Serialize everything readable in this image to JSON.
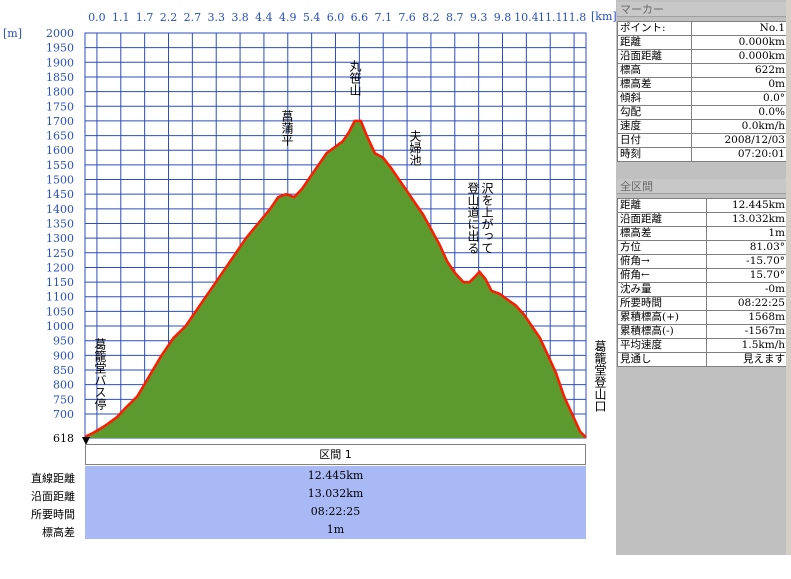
{
  "units": {
    "x": "[km]",
    "y": "[m]"
  },
  "chart_data": {
    "type": "area",
    "xlabel": "[km]",
    "ylabel": "[m]",
    "x_ticks": [
      "0.0",
      "1.1",
      "1.7",
      "2.2",
      "2.7",
      "3.3",
      "3.8",
      "4.4",
      "4.9",
      "5.4",
      "6.0",
      "6.6",
      "7.1",
      "7.6",
      "8.2",
      "8.7",
      "9.3",
      "9.8",
      "10.4",
      "11.1",
      "11.8"
    ],
    "y_ticks": [
      2000,
      1950,
      1900,
      1850,
      1800,
      1750,
      1700,
      1650,
      1600,
      1550,
      1500,
      1450,
      1400,
      1350,
      1300,
      1250,
      1200,
      1150,
      1100,
      1050,
      1000,
      950,
      900,
      850,
      800,
      750,
      700
    ],
    "y_min_label": "618",
    "ylim": [
      618,
      2000
    ],
    "xlim": [
      0,
      12.445
    ],
    "grid": true,
    "series": [
      {
        "x": [
          0,
          0.2,
          0.5,
          0.8,
          1.0,
          1.3,
          1.6,
          1.9,
          2.2,
          2.5,
          2.8,
          3.1,
          3.4,
          3.7,
          4.0,
          4.3,
          4.6,
          4.8,
          5.0,
          5.2,
          5.4,
          5.6,
          5.8,
          6.0,
          6.2,
          6.4,
          6.55,
          6.7,
          6.85,
          7.0,
          7.2,
          7.4,
          7.6,
          7.8,
          8.0,
          8.2,
          8.4,
          8.6,
          8.8,
          9.0,
          9.2,
          9.4,
          9.55,
          9.7,
          9.8,
          9.95,
          10.1,
          10.3,
          10.5,
          10.7,
          10.9,
          11.1,
          11.3,
          11.5,
          11.7,
          11.9,
          12.1,
          12.3,
          12.445
        ],
        "values": [
          622,
          635,
          660,
          690,
          720,
          760,
          830,
          900,
          960,
          1000,
          1060,
          1120,
          1180,
          1240,
          1300,
          1350,
          1400,
          1440,
          1450,
          1440,
          1470,
          1510,
          1550,
          1590,
          1610,
          1630,
          1660,
          1700,
          1700,
          1650,
          1590,
          1575,
          1540,
          1500,
          1460,
          1420,
          1380,
          1330,
          1280,
          1220,
          1180,
          1150,
          1150,
          1170,
          1185,
          1160,
          1120,
          1110,
          1090,
          1070,
          1040,
          1000,
          960,
          900,
          840,
          760,
          700,
          640,
          620
        ]
      }
    ],
    "annotations": [
      "菖蒲平",
      "丸笹山",
      "夫婦池",
      "沢を上がって",
      "登山道に出る",
      "葛籠堂バス停",
      "葛籠堂登山口"
    ]
  },
  "segment": {
    "header": "区間 1",
    "rows": [
      {
        "label": "直線距離",
        "value": "12.445km"
      },
      {
        "label": "沿面距離",
        "value": "13.032km"
      },
      {
        "label": "所要時間",
        "value": "08:22:25"
      },
      {
        "label": "標高差",
        "value": "1m"
      }
    ]
  },
  "marker_panel": {
    "title": "マーカー",
    "rows": [
      {
        "label": "ポイント:",
        "value": "No.1"
      },
      {
        "label": "距離",
        "value": "0.000km"
      },
      {
        "label": "沿面距離",
        "value": "0.000km"
      },
      {
        "label": "標高",
        "value": "622m"
      },
      {
        "label": "標高差",
        "value": "0m"
      },
      {
        "label": "傾斜",
        "value": "0.0°"
      },
      {
        "label": "勾配",
        "value": "0.0%"
      },
      {
        "label": "速度",
        "value": "0.0km/h"
      },
      {
        "label": "日付",
        "value": "2008/12/03"
      },
      {
        "label": "時刻",
        "value": "07:20:01"
      }
    ]
  },
  "total_panel": {
    "title": "全区間",
    "rows": [
      {
        "label": "距離",
        "value": "12.445km"
      },
      {
        "label": "沿面距離",
        "value": "13.032km"
      },
      {
        "label": "標高差",
        "value": "1m"
      },
      {
        "label": "方位",
        "value": "81.03°"
      },
      {
        "label": "俯角→",
        "value": "-15.70°"
      },
      {
        "label": "俯角←",
        "value": "15.70°"
      },
      {
        "label": "沈み量",
        "value": "-0m"
      },
      {
        "label": "所要時間",
        "value": "08:22:25"
      },
      {
        "label": "累積標高(+)",
        "value": "1568m"
      },
      {
        "label": "累積標高(-)",
        "value": "-1567m"
      },
      {
        "label": "平均速度",
        "value": "1.5km/h"
      },
      {
        "label": "見通し",
        "value": "見えます"
      }
    ]
  },
  "colors": {
    "fill": "#5c9a2e",
    "line": "#ff1a00",
    "grid": "#2a4fc0",
    "seg_bg": "#a9b9f5"
  }
}
